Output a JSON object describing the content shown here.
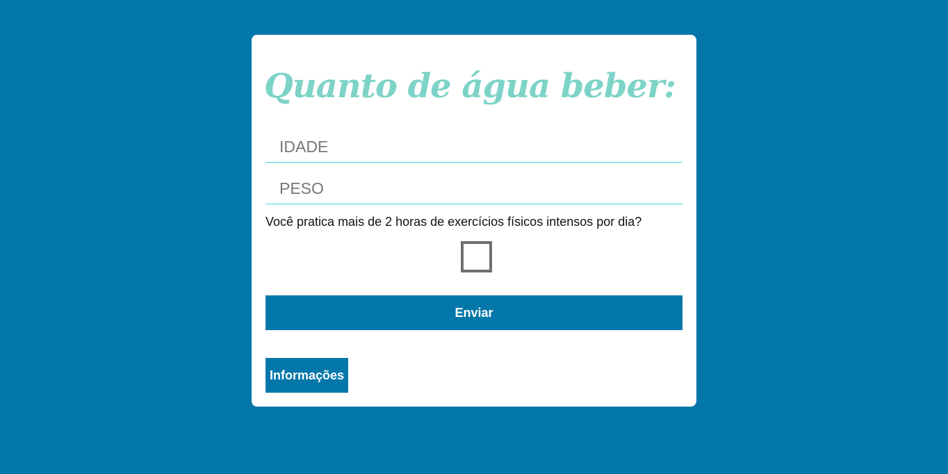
{
  "form": {
    "title": "Quanto de água beber:",
    "age_placeholder": "IDADE",
    "age_value": "",
    "weight_placeholder": "PESO",
    "weight_value": "",
    "exercise_question": "Você pratica mais de 2 horas de exercícios físicos intensos por dia?",
    "exercise_checked": false,
    "submit_label": "Enviar",
    "info_label": "Informações"
  },
  "colors": {
    "background": "#0477aa",
    "card": "#ffffff",
    "title": "#7dd3c7",
    "field_underline": "#3fd6e6",
    "button": "#0477aa"
  }
}
